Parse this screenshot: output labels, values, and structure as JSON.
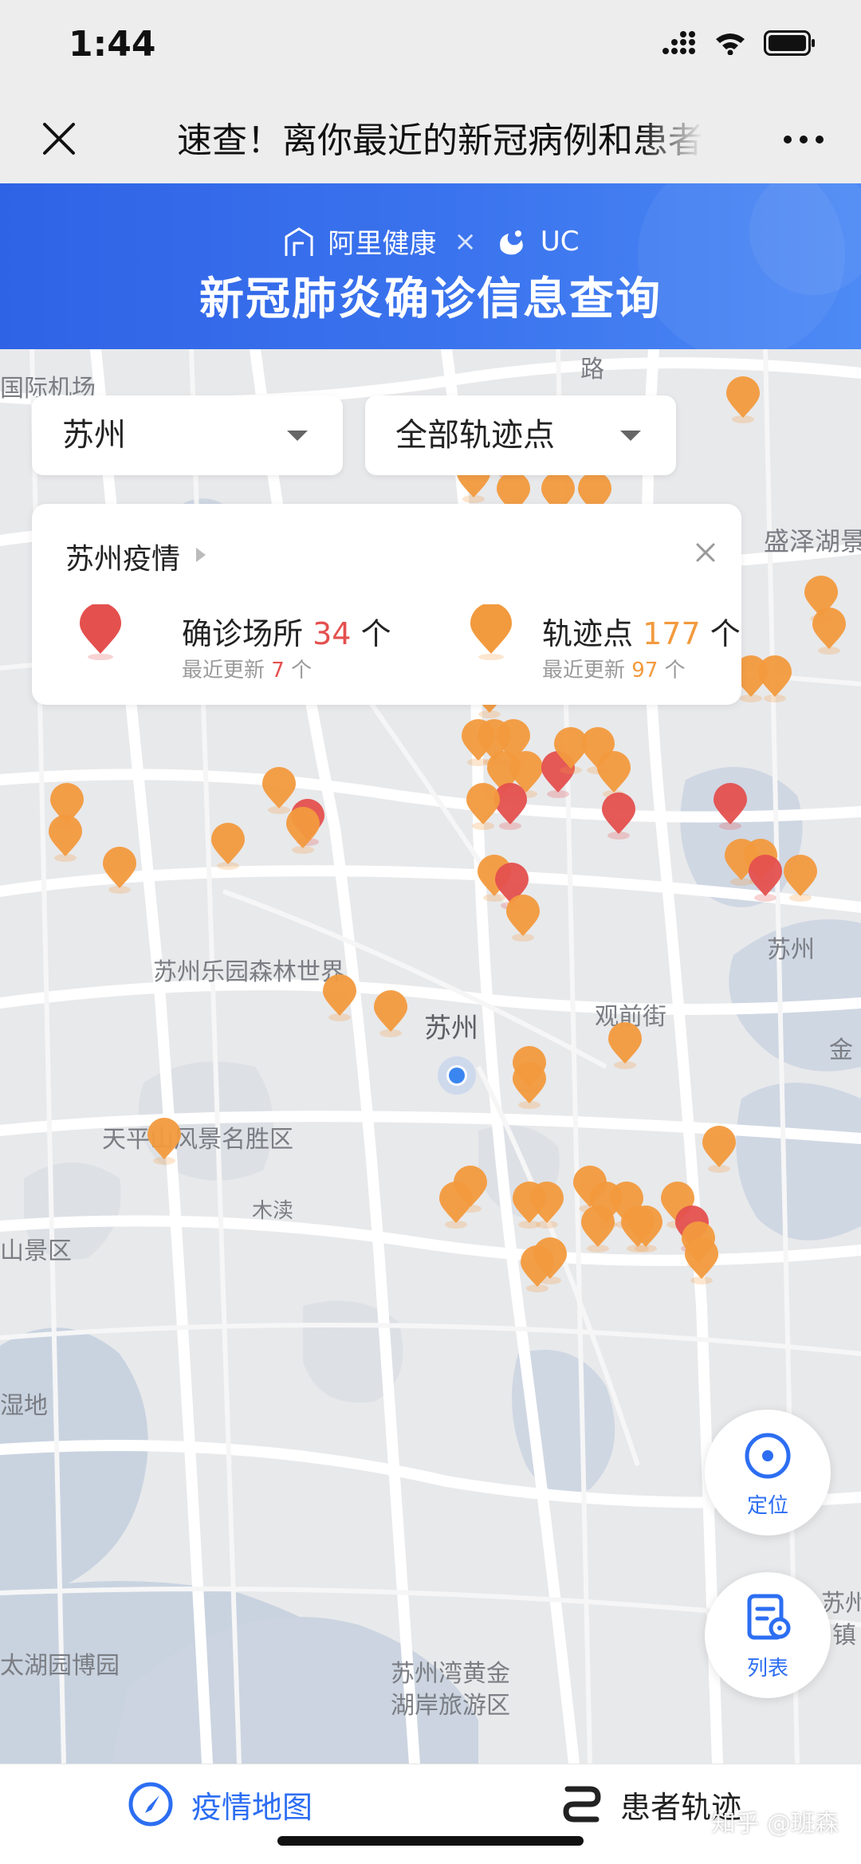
{
  "status_bar": {
    "time": "1:44"
  },
  "nav": {
    "title": "速查！离你最近的新冠病例和患者"
  },
  "banner": {
    "brand_left": "阿里健康",
    "brand_sep": "×",
    "brand_right": "UC",
    "title": "新冠肺炎确诊信息查询",
    "color": "#3a6fec"
  },
  "filters": {
    "city": "苏州",
    "point_type": "全部轨迹点"
  },
  "summary": {
    "title": "苏州疫情",
    "confirmed_label": "确诊场所",
    "confirmed_count": "34",
    "confirmed_unit": "个",
    "confirmed_update_label": "最近更新",
    "confirmed_update_count": "7",
    "confirmed_update_unit": "个",
    "track_label": "轨迹点",
    "track_count": "177",
    "track_unit": "个",
    "track_update_label": "最近更新",
    "track_update_count": "97",
    "track_update_unit": "个",
    "red_color": "#e4504e",
    "orange_color": "#f29a3e"
  },
  "map_labels": {
    "airport": "国际机场",
    "road": "路",
    "shengze_lake": "盛泽湖景",
    "amusement": "苏州乐园森林世界",
    "suzhou": "苏州",
    "guanqian": "观前街",
    "suzhou_right": "苏州",
    "jin": "金",
    "tianping": "天平山风景名胜区",
    "mudu": "木渎",
    "scenic": "山景区",
    "wetland": "湿地",
    "taihu_expo": "太湖园博园",
    "suzhou_bay": "苏州湾黄金",
    "lakeshore": "湖岸旅游区",
    "suzhou_br": "苏州",
    "town": "镇"
  },
  "fabs": {
    "locate": "定位",
    "list": "列表"
  },
  "tabs": {
    "map": "疫情地图",
    "track": "患者轨迹"
  },
  "watermark": "知乎 @班森"
}
